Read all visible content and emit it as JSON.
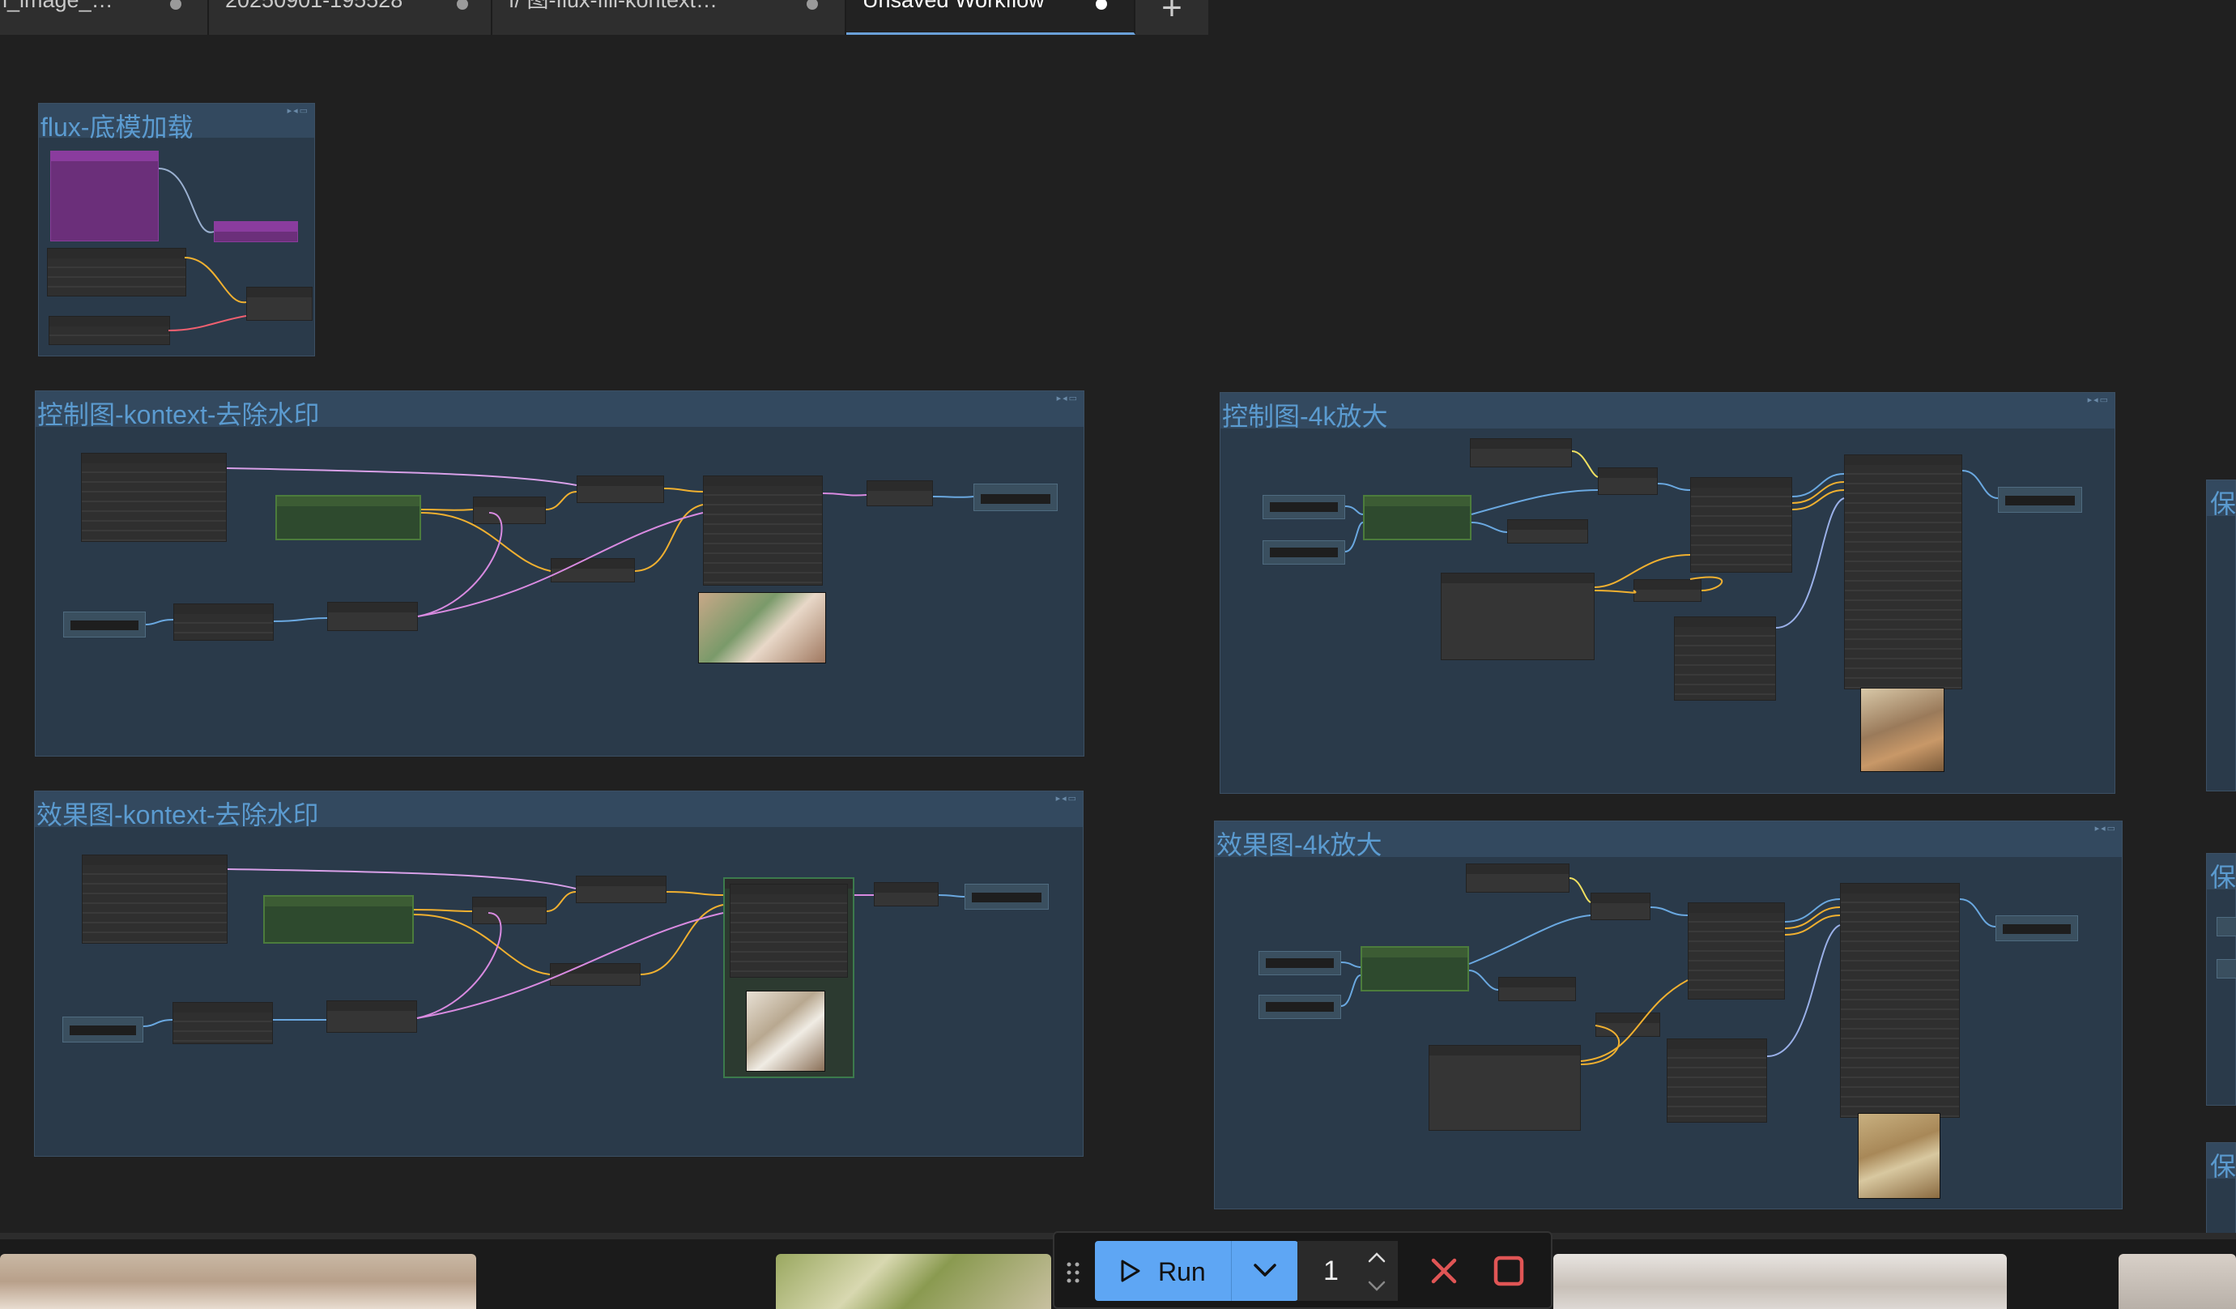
{
  "tabs": [
    {
      "label": "n_image_…"
    },
    {
      "label": "20250901-195528"
    },
    {
      "label": "f/ 图-flux-fill-kontext…"
    },
    {
      "label": "Unsaved Workflow",
      "active": true
    }
  ],
  "groups": {
    "g1": {
      "title": "flux-底模加载"
    },
    "g2": {
      "title": "控制图-kontext-去除水印"
    },
    "g3": {
      "title": "控制图-4k放大"
    },
    "g4": {
      "title": "效果图-kontext-去除水印"
    },
    "g5": {
      "title": "效果图-4k放大"
    },
    "side": {
      "title": "保"
    }
  },
  "run_bar": {
    "run_label": "Run",
    "batch_count": "1"
  },
  "colors": {
    "canvas": "#202020",
    "group_body": "#2a3a4a",
    "group_title": "#5b9bd0",
    "run_button": "#5ea6f4",
    "cancel": "#e05555"
  },
  "icons": [
    "play-icon",
    "chevron-down-icon",
    "chevron-up-icon",
    "close-icon",
    "stop-icon",
    "drag-handle-icon",
    "plus-icon"
  ]
}
